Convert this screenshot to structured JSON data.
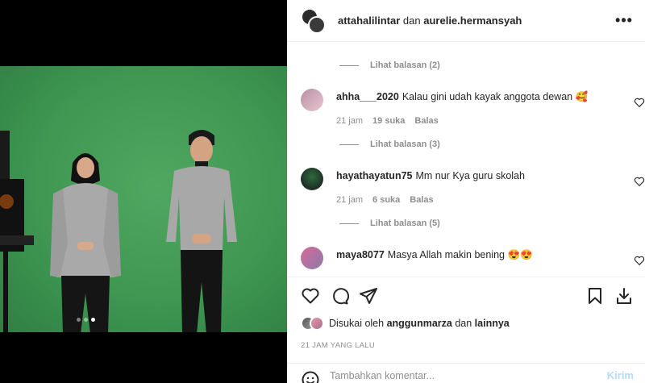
{
  "post": {
    "authors": {
      "first": "attahalilintar",
      "conjunction": "dan",
      "second": "aurelie.hermansyah"
    },
    "more_label": "•••"
  },
  "media": {
    "carousel_count": 3,
    "active_index": 2
  },
  "comments": [
    {
      "type": "replies",
      "label": "Lihat balasan (2)"
    },
    {
      "type": "comment",
      "username": "ahha___2020",
      "text": "Kalau gini udah kayak anggota dewan 🥰",
      "time": "21 jam",
      "likes": "19 suka",
      "reply": "Balas"
    },
    {
      "type": "replies",
      "label": "Lihat balasan (3)"
    },
    {
      "type": "comment",
      "username": "hayathayatun75",
      "text": "Mm nur Kya guru skolah",
      "time": "21 jam",
      "likes": "6 suka",
      "reply": "Balas"
    },
    {
      "type": "replies",
      "label": "Lihat balasan (5)"
    },
    {
      "type": "comment",
      "username": "maya8077",
      "text": "Masya Allah makin bening 😍😍",
      "time": "",
      "likes": "",
      "reply": ""
    }
  ],
  "likes": {
    "prefix": "Disukai oleh",
    "user": "anggunmarza",
    "conjunction": "dan",
    "others": "lainnya"
  },
  "timestamp": "21 JAM YANG LALU",
  "add_comment": {
    "placeholder": "Tambahkan komentar...",
    "post_label": "Kirim"
  },
  "colors": {
    "green_screen": "#3f9752",
    "muted": "#8e8e8e",
    "post_button": "#b3dbff"
  }
}
